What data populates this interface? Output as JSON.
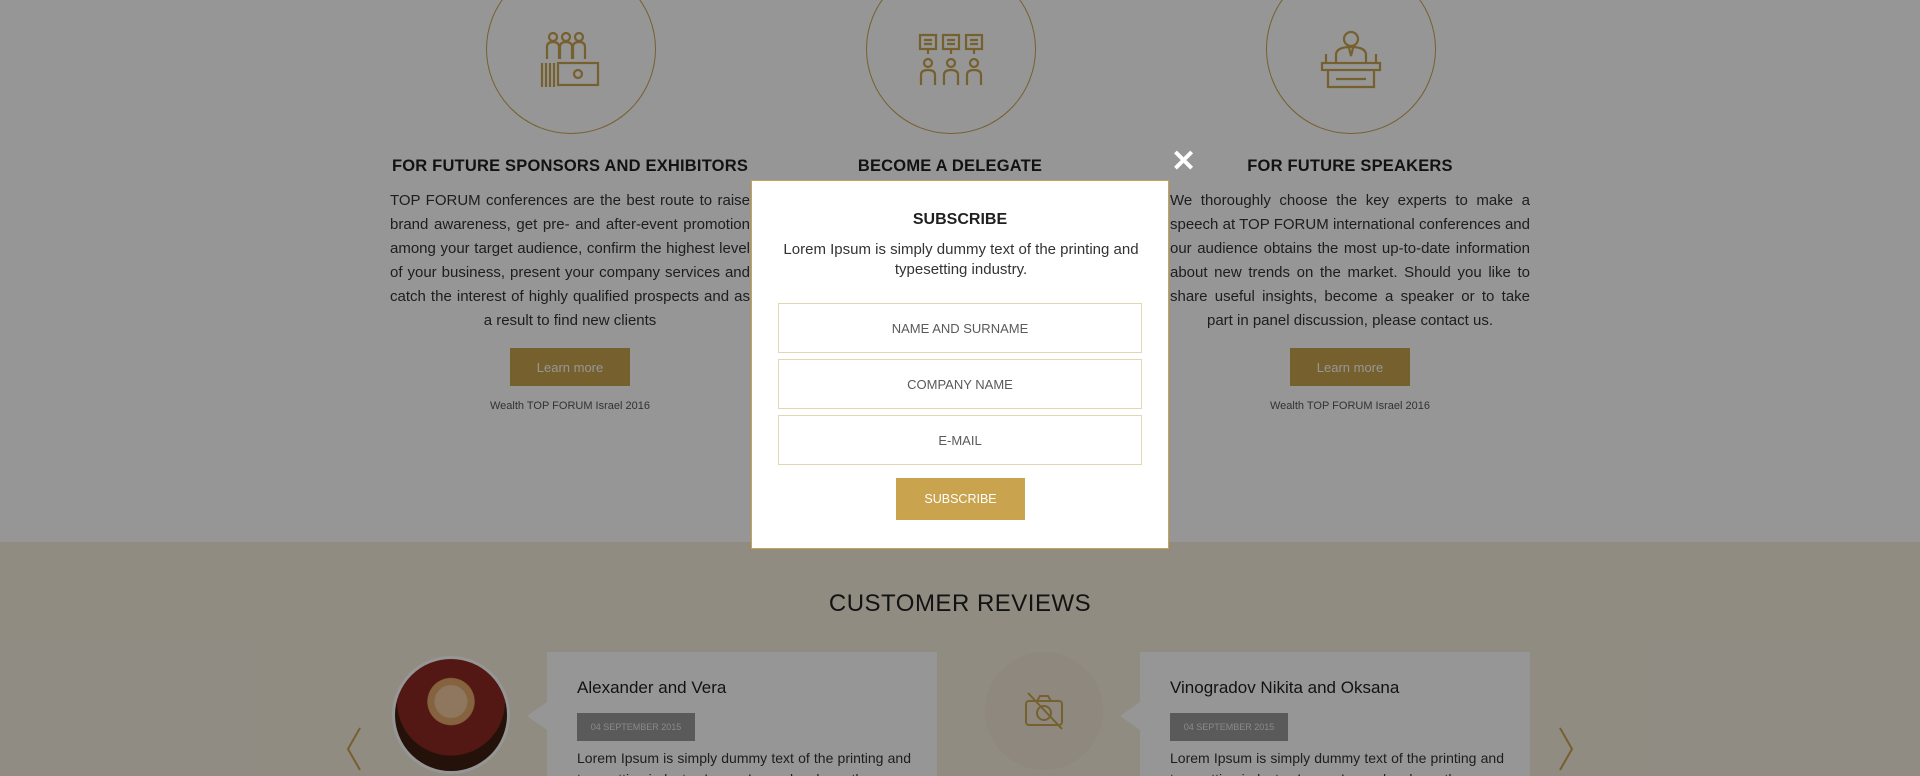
{
  "features": [
    {
      "icon": "sponsors-icon",
      "title": "FOR FUTURE SPONSORS AND EXHIBITORS",
      "text": "TOP FORUM conferences are the best route to raise brand awareness, get pre- and after-event promotion among your target audience, confirm the highest level of your business, present your company services and catch the interest of highly qualified prospects and as a result to find new clients",
      "button": "Learn more",
      "caption": "Wealth TOP FORUM Israel 2016"
    },
    {
      "icon": "delegates-icon",
      "title": "BECOME A DELEGATE"
    },
    {
      "icon": "speaker-icon",
      "title": "FOR FUTURE SPEAKERS",
      "text": "We thoroughly choose the key experts to make a speech at TOP FORUM international conferences and our audience obtains the most up-to-date information about new trends on the market. Should you like to share useful insights, become a speaker or to take part in panel discussion, please contact us.",
      "button": "Learn more",
      "caption": "Wealth TOP FORUM Israel 2016"
    }
  ],
  "reviews": {
    "title": "CUSTOMER REVIEWS",
    "items": [
      {
        "name": "Alexander and Vera",
        "date": "04 SEPTEMBER 2015",
        "text": "Lorem Ipsum is simply dummy text of the printing and typesetting industry. Lorem Ipsum has been the"
      },
      {
        "name": "Vinogradov Nikita and Oksana",
        "date": "04 SEPTEMBER 2015",
        "text": "Lorem Ipsum is simply dummy text of the printing and typesetting industry. Lorem Ipsum has been the"
      }
    ]
  },
  "modal": {
    "close": "✕",
    "title": "SUBSCRIBE",
    "text": "Lorem Ipsum is simply dummy text of the printing and typesetting industry.",
    "name_placeholder": "NAME AND SURNAME",
    "company_placeholder": "COMPANY NAME",
    "email_placeholder": "E-MAIL",
    "button": "SUBSCRIBE"
  },
  "colors": {
    "accent": "#c9a34e",
    "reviews_bg": "#f6eede",
    "overlay": "rgba(0,0,0,0.41)"
  }
}
